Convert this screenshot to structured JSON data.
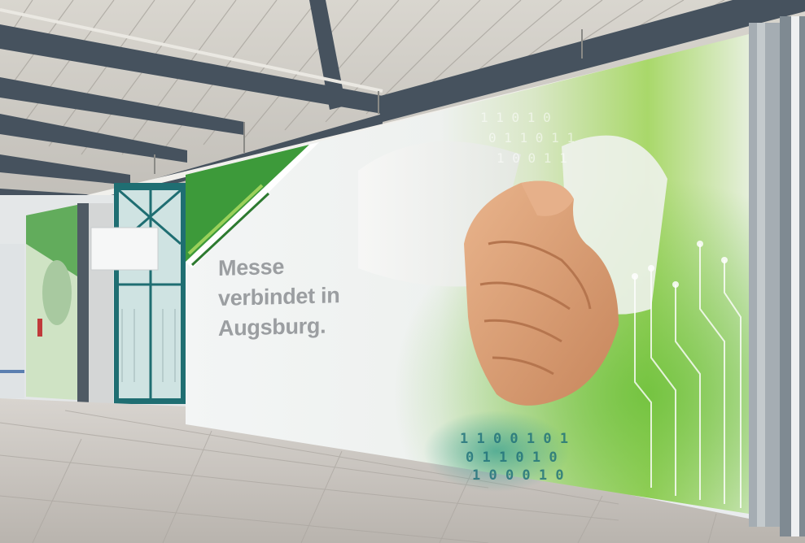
{
  "banner": {
    "headline_lines": [
      "Messe",
      "verbindet in",
      "Augsburg."
    ]
  },
  "colors": {
    "accent_green": "#3d9a3a",
    "light_green": "#9bd15a",
    "steel": "#46525e",
    "floor": "#c9c5c0"
  },
  "icons": [
    "handshake-image",
    "circuit-pattern",
    "binary-code-pattern"
  ]
}
